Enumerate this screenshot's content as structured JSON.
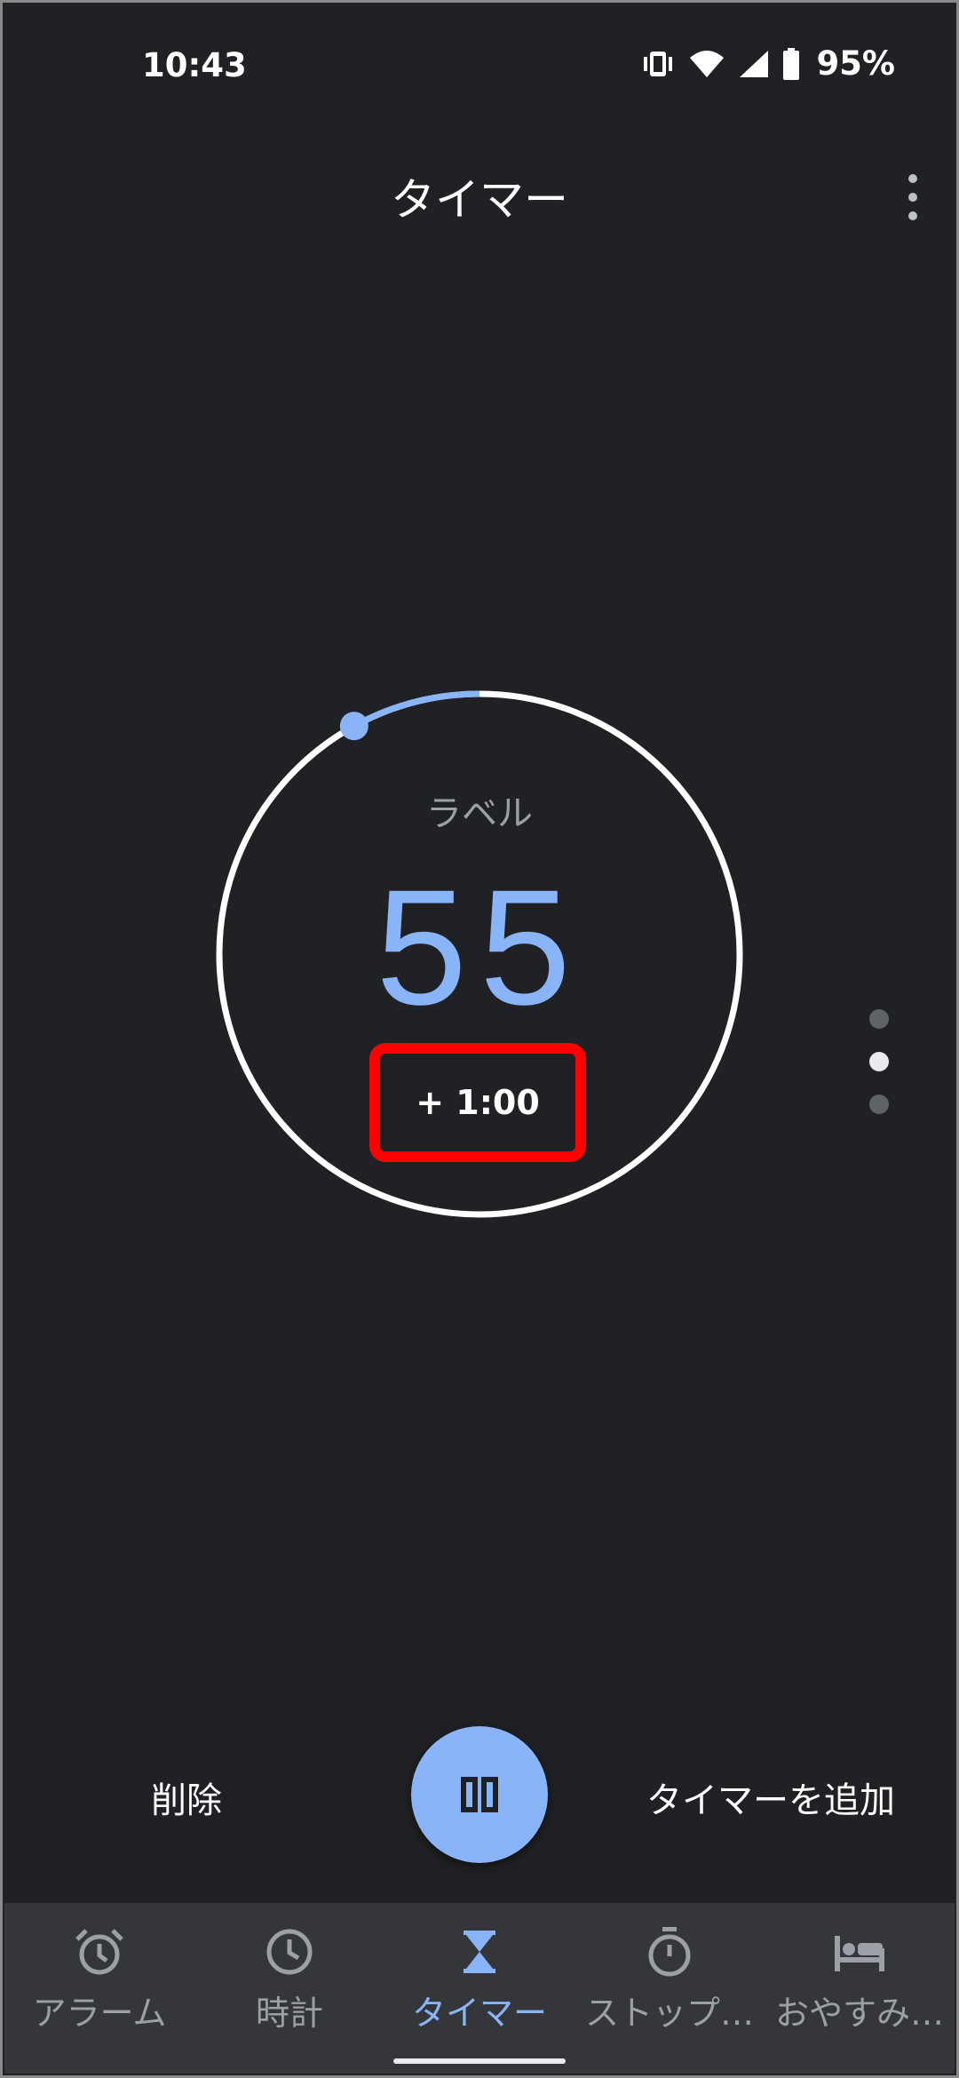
{
  "status": {
    "time": "10:43",
    "battery": "95%"
  },
  "header": {
    "title": "タイマー"
  },
  "timer": {
    "label_placeholder": "ラベル",
    "remaining": "55",
    "add_minute": "+ 1:00",
    "progress_fraction": 0.92
  },
  "pager": {
    "count": 3,
    "active": 1
  },
  "actions": {
    "delete": "削除",
    "add_timer": "タイマーを追加"
  },
  "nav": {
    "items": [
      {
        "label": "アラーム",
        "icon": "alarm-icon"
      },
      {
        "label": "時計",
        "icon": "clock-icon"
      },
      {
        "label": "タイマー",
        "icon": "hourglass-icon",
        "active": true
      },
      {
        "label": "ストップ…",
        "icon": "stopwatch-icon"
      },
      {
        "label": "おやすみ…",
        "icon": "bed-icon"
      }
    ]
  },
  "colors": {
    "accent": "#8ab4f8",
    "background": "#202124",
    "nav_background": "#35363a",
    "highlight_box": "#ff0000"
  }
}
